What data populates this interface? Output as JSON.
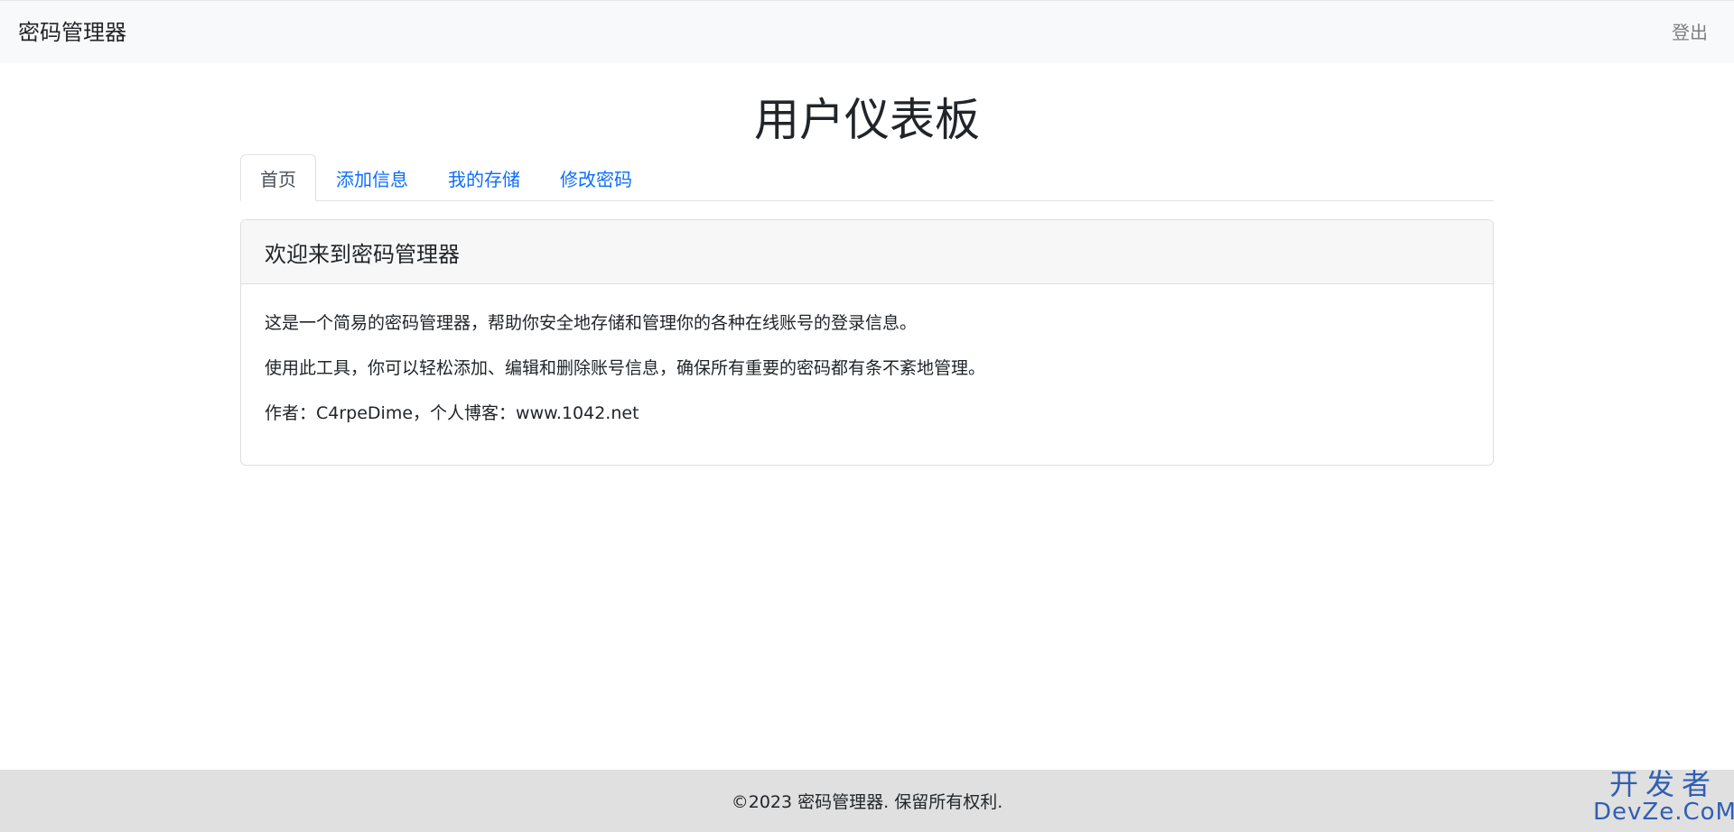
{
  "navbar": {
    "brand": "密码管理器",
    "logout": "登出"
  },
  "main": {
    "title": "用户仪表板",
    "tabs": [
      {
        "label": "首页",
        "active": true
      },
      {
        "label": "添加信息",
        "active": false
      },
      {
        "label": "我的存储",
        "active": false
      },
      {
        "label": "修改密码",
        "active": false
      }
    ],
    "card": {
      "header": "欢迎来到密码管理器",
      "paragraphs": [
        "这是一个简易的密码管理器，帮助你安全地存储和管理你的各种在线账号的登录信息。",
        "使用此工具，你可以轻松添加、编辑和删除账号信息，确保所有重要的密码都有条不紊地管理。",
        "作者：C4rpeDime，个人博客：www.1042.net"
      ]
    }
  },
  "footer": {
    "text": "©2023 密码管理器. 保留所有权利."
  },
  "watermark": {
    "top": "开发者",
    "bottom": "DevZe.CoM"
  },
  "colors": {
    "navbar_bg": "#f8f9fa",
    "link": "#0d6efd",
    "footer_bg": "#e0e0e0",
    "watermark": "#2f5fb3"
  }
}
